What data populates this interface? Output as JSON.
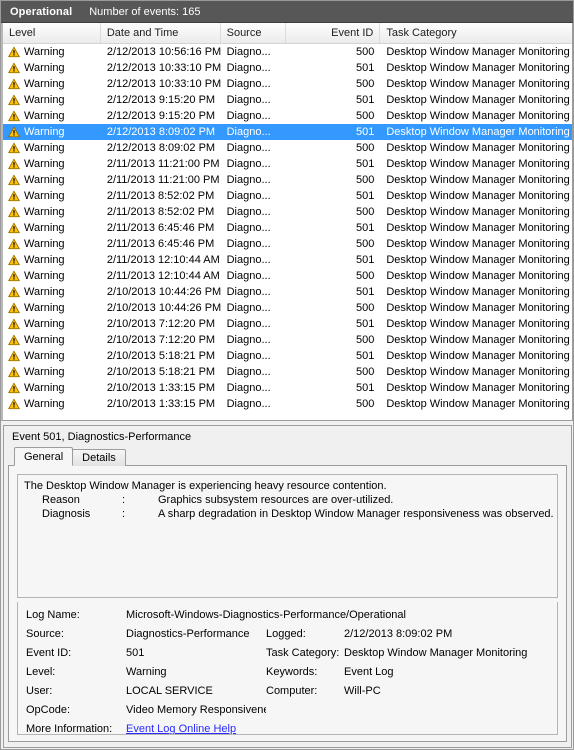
{
  "caption": {
    "log_name": "Operational",
    "event_count_label": "Number of events: 165"
  },
  "list": {
    "columns": [
      {
        "key": "level",
        "label": "Level"
      },
      {
        "key": "datetime",
        "label": "Date and Time"
      },
      {
        "key": "source",
        "label": "Source"
      },
      {
        "key": "event_id",
        "label": "Event ID"
      },
      {
        "key": "task_category",
        "label": "Task Category"
      }
    ],
    "rows": [
      {
        "icon": "warning-icon",
        "level": "Warning",
        "datetime": "2/12/2013 10:56:16 PM",
        "source": "Diagno...",
        "event_id": "500",
        "task_category": "Desktop Window Manager Monitoring",
        "selected": false
      },
      {
        "icon": "warning-icon",
        "level": "Warning",
        "datetime": "2/12/2013 10:33:10 PM",
        "source": "Diagno...",
        "event_id": "501",
        "task_category": "Desktop Window Manager Monitoring",
        "selected": false
      },
      {
        "icon": "warning-icon",
        "level": "Warning",
        "datetime": "2/12/2013 10:33:10 PM",
        "source": "Diagno...",
        "event_id": "500",
        "task_category": "Desktop Window Manager Monitoring",
        "selected": false
      },
      {
        "icon": "warning-icon",
        "level": "Warning",
        "datetime": "2/12/2013 9:15:20 PM",
        "source": "Diagno...",
        "event_id": "501",
        "task_category": "Desktop Window Manager Monitoring",
        "selected": false
      },
      {
        "icon": "warning-icon",
        "level": "Warning",
        "datetime": "2/12/2013 9:15:20 PM",
        "source": "Diagno...",
        "event_id": "500",
        "task_category": "Desktop Window Manager Monitoring",
        "selected": false
      },
      {
        "icon": "warning-icon",
        "level": "Warning",
        "datetime": "2/12/2013 8:09:02 PM",
        "source": "Diagno...",
        "event_id": "501",
        "task_category": "Desktop Window Manager Monitoring",
        "selected": true
      },
      {
        "icon": "warning-icon",
        "level": "Warning",
        "datetime": "2/12/2013 8:09:02 PM",
        "source": "Diagno...",
        "event_id": "500",
        "task_category": "Desktop Window Manager Monitoring",
        "selected": false
      },
      {
        "icon": "warning-icon",
        "level": "Warning",
        "datetime": "2/11/2013 11:21:00 PM",
        "source": "Diagno...",
        "event_id": "501",
        "task_category": "Desktop Window Manager Monitoring",
        "selected": false
      },
      {
        "icon": "warning-icon",
        "level": "Warning",
        "datetime": "2/11/2013 11:21:00 PM",
        "source": "Diagno...",
        "event_id": "500",
        "task_category": "Desktop Window Manager Monitoring",
        "selected": false
      },
      {
        "icon": "warning-icon",
        "level": "Warning",
        "datetime": "2/11/2013 8:52:02 PM",
        "source": "Diagno...",
        "event_id": "501",
        "task_category": "Desktop Window Manager Monitoring",
        "selected": false
      },
      {
        "icon": "warning-icon",
        "level": "Warning",
        "datetime": "2/11/2013 8:52:02 PM",
        "source": "Diagno...",
        "event_id": "500",
        "task_category": "Desktop Window Manager Monitoring",
        "selected": false
      },
      {
        "icon": "warning-icon",
        "level": "Warning",
        "datetime": "2/11/2013 6:45:46 PM",
        "source": "Diagno...",
        "event_id": "501",
        "task_category": "Desktop Window Manager Monitoring",
        "selected": false
      },
      {
        "icon": "warning-icon",
        "level": "Warning",
        "datetime": "2/11/2013 6:45:46 PM",
        "source": "Diagno...",
        "event_id": "500",
        "task_category": "Desktop Window Manager Monitoring",
        "selected": false
      },
      {
        "icon": "warning-icon",
        "level": "Warning",
        "datetime": "2/11/2013 12:10:44 AM",
        "source": "Diagno...",
        "event_id": "501",
        "task_category": "Desktop Window Manager Monitoring",
        "selected": false
      },
      {
        "icon": "warning-icon",
        "level": "Warning",
        "datetime": "2/11/2013 12:10:44 AM",
        "source": "Diagno...",
        "event_id": "500",
        "task_category": "Desktop Window Manager Monitoring",
        "selected": false
      },
      {
        "icon": "warning-icon",
        "level": "Warning",
        "datetime": "2/10/2013 10:44:26 PM",
        "source": "Diagno...",
        "event_id": "501",
        "task_category": "Desktop Window Manager Monitoring",
        "selected": false
      },
      {
        "icon": "warning-icon",
        "level": "Warning",
        "datetime": "2/10/2013 10:44:26 PM",
        "source": "Diagno...",
        "event_id": "500",
        "task_category": "Desktop Window Manager Monitoring",
        "selected": false
      },
      {
        "icon": "warning-icon",
        "level": "Warning",
        "datetime": "2/10/2013 7:12:20 PM",
        "source": "Diagno...",
        "event_id": "501",
        "task_category": "Desktop Window Manager Monitoring",
        "selected": false
      },
      {
        "icon": "warning-icon",
        "level": "Warning",
        "datetime": "2/10/2013 7:12:20 PM",
        "source": "Diagno...",
        "event_id": "500",
        "task_category": "Desktop Window Manager Monitoring",
        "selected": false
      },
      {
        "icon": "warning-icon",
        "level": "Warning",
        "datetime": "2/10/2013 5:18:21 PM",
        "source": "Diagno...",
        "event_id": "501",
        "task_category": "Desktop Window Manager Monitoring",
        "selected": false
      },
      {
        "icon": "warning-icon",
        "level": "Warning",
        "datetime": "2/10/2013 5:18:21 PM",
        "source": "Diagno...",
        "event_id": "500",
        "task_category": "Desktop Window Manager Monitoring",
        "selected": false
      },
      {
        "icon": "warning-icon",
        "level": "Warning",
        "datetime": "2/10/2013 1:33:15 PM",
        "source": "Diagno...",
        "event_id": "501",
        "task_category": "Desktop Window Manager Monitoring",
        "selected": false
      },
      {
        "icon": "warning-icon",
        "level": "Warning",
        "datetime": "2/10/2013 1:33:15 PM",
        "source": "Diagno...",
        "event_id": "500",
        "task_category": "Desktop Window Manager Monitoring",
        "selected": false
      }
    ]
  },
  "detail": {
    "title": "Event 501, Diagnostics-Performance",
    "tabs": [
      {
        "label": "General",
        "active": true
      },
      {
        "label": "Details",
        "active": false
      }
    ],
    "message": {
      "headline": "The Desktop Window Manager is experiencing heavy resource contention.",
      "entries": [
        {
          "key": "Reason",
          "sep": ":",
          "value": "Graphics subsystem resources are over-utilized."
        },
        {
          "key": "Diagnosis",
          "sep": ":",
          "value": "A sharp degradation in Desktop Window Manager responsiveness was observed."
        }
      ]
    },
    "properties": {
      "log_name_label": "Log Name:",
      "log_name_value": "Microsoft-Windows-Diagnostics-Performance/Operational",
      "source_label": "Source:",
      "source_value": "Diagnostics-Performance",
      "logged_label": "Logged:",
      "logged_value": "2/12/2013 8:09:02 PM",
      "event_id_label": "Event ID:",
      "event_id_value": "501",
      "task_category_label": "Task Category:",
      "task_category_value": "Desktop Window Manager Monitoring",
      "level_label": "Level:",
      "level_value": "Warning",
      "keywords_label": "Keywords:",
      "keywords_value": "Event Log",
      "user_label": "User:",
      "user_value": "LOCAL SERVICE",
      "computer_label": "Computer:",
      "computer_value": "Will-PC",
      "opcode_label": "OpCode:",
      "opcode_value": "Video Memory Responsiveness",
      "more_info_label": "More Information:",
      "more_info_link": "Event Log Online Help"
    }
  },
  "colors": {
    "caption_bar": "#575757",
    "selection": "#3399ff",
    "warning_icon": "#ffc000",
    "link": "#2a2aff"
  }
}
